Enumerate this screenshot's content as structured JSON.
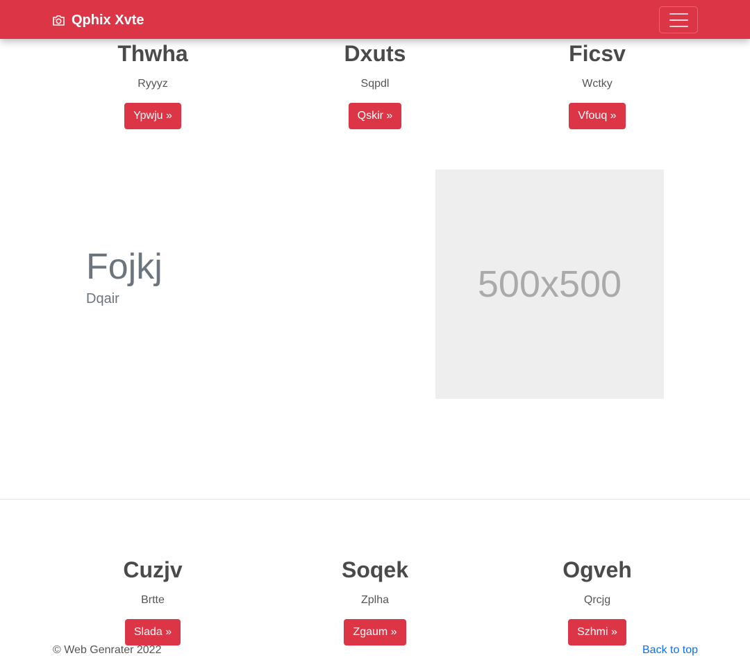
{
  "navbar": {
    "brand": "Qphix Xvte",
    "brand_icon": "camera-icon",
    "toggler_icon": "hamburger-menu-icon",
    "color": "#dc3545"
  },
  "top_columns": [
    {
      "heading": "Thwha",
      "text": "Ryyyz",
      "button": "Ypwju »"
    },
    {
      "heading": "Dxuts",
      "text": "Sqpdl",
      "button": "Qskir »"
    },
    {
      "heading": "Ficsv",
      "text": "Wctky",
      "button": "Vfouq »"
    }
  ],
  "feature": {
    "heading": "Fojkj",
    "subheading": "Dqair",
    "image_label": "500x500"
  },
  "bottom_columns": [
    {
      "heading": "Cuzjv",
      "text": "Brtte",
      "button": "Slada »"
    },
    {
      "heading": "Soqek",
      "text": "Zplha",
      "button": "Zgaum »"
    },
    {
      "heading": "Ogveh",
      "text": "Qrcjg",
      "button": "Szhmi »"
    }
  ],
  "footer": {
    "copyright": "© Web Genrater 2022",
    "back_to_top": "Back to top",
    "link_color": "#0d6efd"
  }
}
